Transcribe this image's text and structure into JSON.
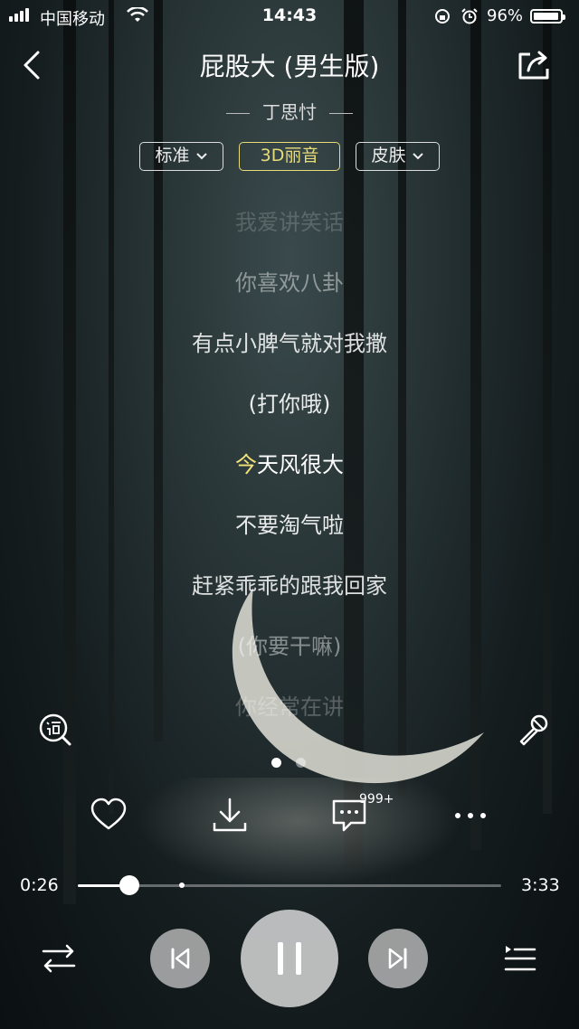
{
  "status_bar": {
    "carrier": "中国移动",
    "time": "14:43",
    "battery_percent": "96%",
    "battery_level": 0.96
  },
  "header": {
    "title": "屁股大 (男生版)",
    "artist": "丁思忖"
  },
  "modes": [
    {
      "label": "标准",
      "dropdown": true
    },
    {
      "label": "3D丽音",
      "dropdown": false,
      "active": true
    },
    {
      "label": "皮肤",
      "dropdown": true
    }
  ],
  "lyrics": [
    {
      "text": "我爱讲笑话",
      "style": "faint"
    },
    {
      "text": "你喜欢八卦",
      "style": "dim"
    },
    {
      "text": "有点小脾气就对我撒",
      "style": "normal"
    },
    {
      "text": "(打你哦)",
      "style": "normal"
    },
    {
      "text_highlight": "今",
      "text_rest": "天风很大",
      "style": "current"
    },
    {
      "text": "不要淘气啦",
      "style": "normal"
    },
    {
      "text": "赶紧乖乖的跟我回家",
      "style": "normal"
    },
    {
      "text": "(你要干嘛)",
      "style": "dim"
    },
    {
      "text": "你经常在讲",
      "style": "faint"
    }
  ],
  "icons": {
    "lyrics_search": "lyrics-search-icon",
    "microphone": "microphone-icon",
    "favorite": "heart-icon",
    "download": "download-icon",
    "comment": "comment-icon",
    "more": "more-icon"
  },
  "comment_badge": "999+",
  "page_indicator": {
    "count": 2,
    "active_index": 0
  },
  "progress": {
    "elapsed": "0:26",
    "total": "3:33",
    "played_fraction": 0.122,
    "buffered_fraction": 0.245
  },
  "controls": {
    "shuffle": "repeat-shuffle-icon",
    "previous": "previous-icon",
    "play_pause": "pause-icon",
    "next": "next-icon",
    "playlist": "playlist-icon"
  },
  "colors": {
    "highlight": "#f3e37a",
    "active_chip": "#e8dc7a"
  }
}
